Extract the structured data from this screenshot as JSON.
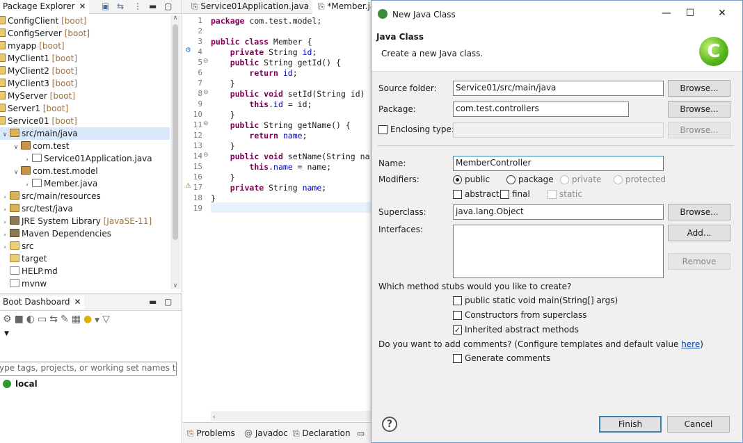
{
  "explorer": {
    "tab_label": "Package Explorer",
    "items": [
      {
        "name": "ConfigClient",
        "tag": "[boot]"
      },
      {
        "name": "ConfigServer",
        "tag": "[boot]"
      },
      {
        "name": "myapp",
        "tag": "[boot]"
      },
      {
        "name": "MyClient1",
        "tag": "[boot]"
      },
      {
        "name": "MyClient2",
        "tag": "[boot]"
      },
      {
        "name": "MyClient3",
        "tag": "[boot]"
      },
      {
        "name": "MyServer",
        "tag": "[boot]"
      },
      {
        "name": "Server1",
        "tag": "[boot]"
      },
      {
        "name": "Service01",
        "tag": "[boot]"
      },
      {
        "name": "src/main/java"
      },
      {
        "name": "com.test"
      },
      {
        "name": "Service01Application.java"
      },
      {
        "name": "com.test.model"
      },
      {
        "name": "Member.java"
      },
      {
        "name": "src/main/resources"
      },
      {
        "name": "src/test/java"
      },
      {
        "name": "JRE System Library",
        "tag": "[JavaSE-11]"
      },
      {
        "name": "Maven Dependencies"
      },
      {
        "name": "src"
      },
      {
        "name": "target"
      },
      {
        "name": "HELP.md"
      },
      {
        "name": "mvnw"
      }
    ]
  },
  "boot_dashboard": {
    "tab_label": "Boot Dashboard",
    "filter_placeholder": "ype tags, projects, or working set names to mat",
    "item": "local"
  },
  "editor": {
    "tabs": [
      "Service01Application.java",
      "*Member.ja"
    ],
    "line_numbers": [
      "1",
      "2",
      "3",
      "4",
      "5",
      "6",
      "7",
      "8",
      "9",
      "10",
      "11",
      "12",
      "13",
      "14",
      "15",
      "16",
      "17",
      "18",
      "19"
    ],
    "lines": [
      "package com.test.model;",
      "",
      "public class Member {",
      "    private String id;",
      "    public String getId() {",
      "        return id;",
      "    }",
      "    public void setId(String id)",
      "        this.id = id;",
      "    }",
      "    public String getName() {",
      "        return name;",
      "    }",
      "    public void setName(String na",
      "        this.name = name;",
      "    }",
      "    private String name;",
      "}",
      ""
    ]
  },
  "bottom_tabs": [
    "Problems",
    "Javadoc",
    "Declaration"
  ],
  "dialog": {
    "title": "New Java Class",
    "header_title": "Java Class",
    "header_desc": "Create a new Java class.",
    "source_folder_label": "Source folder:",
    "source_folder_value": "Service01/src/main/java",
    "package_label": "Package:",
    "package_value": "com.test.controllers",
    "enclosing_label": "Enclosing type:",
    "name_label": "Name:",
    "name_value": "MemberController",
    "modifiers_label": "Modifiers:",
    "mod_public": "public",
    "mod_package": "package",
    "mod_private": "private",
    "mod_protected": "protected",
    "mod_abstract": "abstract",
    "mod_final": "final",
    "mod_static": "static",
    "superclass_label": "Superclass:",
    "superclass_value": "java.lang.Object",
    "interfaces_label": "Interfaces:",
    "browse": "Browse...",
    "add": "Add...",
    "remove": "Remove",
    "stubs_question": "Which method stubs would you like to create?",
    "stub_main": "public static void main(String[] args)",
    "stub_ctor": "Constructors from superclass",
    "stub_inherited": "Inherited abstract methods",
    "comments_question": "Do you want to add comments? (Configure templates and default value ",
    "comments_link": "here",
    "comments_close": ")",
    "gen_comments": "Generate comments",
    "finish": "Finish",
    "cancel": "Cancel"
  }
}
